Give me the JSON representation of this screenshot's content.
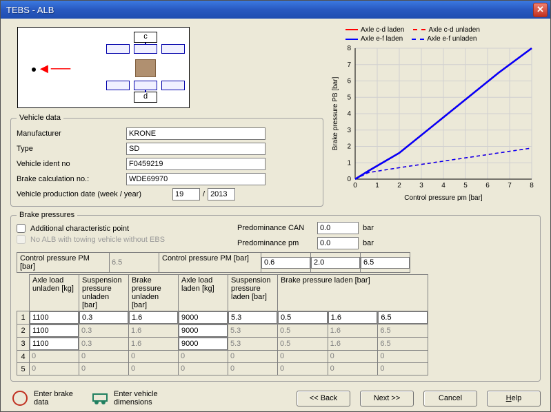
{
  "window": {
    "title": "TEBS - ALB"
  },
  "diagram": {
    "label_c": "c",
    "label_d": "d"
  },
  "vehicle_data": {
    "legend": "Vehicle data",
    "manufacturer_lbl": "Manufacturer",
    "manufacturer": "KRONE",
    "type_lbl": "Type",
    "type": "SD",
    "ident_lbl": "Vehicle ident no",
    "ident": "F0459219",
    "calc_lbl": "Brake calculation no.:",
    "calc": "WDE69970",
    "prod_date_lbl": "Vehicle production date (week / year)",
    "prod_week": "19",
    "prod_sep": "/",
    "prod_year": "2013"
  },
  "brake": {
    "legend": "Brake pressures",
    "addl_chk_lbl": "Additional characteristic point",
    "noalb_chk_lbl": "No ALB with towing vehicle without EBS",
    "pred_can_lbl": "Predominance CAN",
    "pred_can": "0.0",
    "pred_pm_lbl": "Predominance pm",
    "pred_pm": "0.0",
    "unit_bar": "bar",
    "cp_pm_lbl": "Control pressure PM [bar]",
    "cp_pm_left": "6.5",
    "cp_pm_r1": "0.6",
    "cp_pm_r2": "2.0",
    "cp_pm_r3": "6.5",
    "headers": {
      "c1": "Axle load unladen [kg]",
      "c2": "Suspension pressure unladen [bar]",
      "c3": "Brake pressure unladen [bar]",
      "c4": "Axle load laden [kg]",
      "c5": "Suspension pressure laden [bar]",
      "c6": "Brake pressure laden [bar]"
    },
    "rows": [
      {
        "n": "1",
        "c1": "1100",
        "c2": "0.3",
        "c3": "1.6",
        "c4": "9000",
        "c5": "5.3",
        "c6a": "0.5",
        "c6b": "1.6",
        "c6c": "6.5",
        "editable": true
      },
      {
        "n": "2",
        "c1": "1100",
        "c2": "0.3",
        "c3": "1.6",
        "c4": "9000",
        "c5": "5.3",
        "c6a": "0.5",
        "c6b": "1.6",
        "c6c": "6.5",
        "editable": false
      },
      {
        "n": "3",
        "c1": "1100",
        "c2": "0.3",
        "c3": "1.6",
        "c4": "9000",
        "c5": "5.3",
        "c6a": "0.5",
        "c6b": "1.6",
        "c6c": "6.5",
        "editable": false
      },
      {
        "n": "4",
        "c1": "0",
        "c2": "0",
        "c3": "0",
        "c4": "0",
        "c5": "0",
        "c6a": "0",
        "c6b": "0",
        "c6c": "0",
        "editable": false
      },
      {
        "n": "5",
        "c1": "0",
        "c2": "0",
        "c3": "0",
        "c4": "0",
        "c5": "0",
        "c6a": "0",
        "c6b": "0",
        "c6c": "0",
        "editable": false
      }
    ]
  },
  "buttons": {
    "enter_brake": "Enter brake data",
    "enter_veh": "Enter vehicle dimensions",
    "back": "<< Back",
    "next": "Next >>",
    "cancel": "Cancel",
    "help": "Help"
  },
  "chart_data": {
    "type": "line",
    "title": "",
    "xlabel": "Control pressure pm [bar]",
    "ylabel": "Brake pressure PB [bar]",
    "xlim": [
      0,
      8
    ],
    "ylim": [
      0,
      8
    ],
    "x": [
      0,
      0.6,
      2.0,
      6.5,
      8.0
    ],
    "series": [
      {
        "name": "Axle c-d laden",
        "color": "#ff0000",
        "dash": false,
        "values": [
          0,
          0.5,
          1.6,
          6.5,
          8.0
        ]
      },
      {
        "name": "Axle c-d unladen",
        "color": "#ff0000",
        "dash": true,
        "values": [
          0,
          0.4,
          0.7,
          1.6,
          1.9
        ]
      },
      {
        "name": "Axle e-f laden",
        "color": "#0000ff",
        "dash": false,
        "values": [
          0,
          0.5,
          1.6,
          6.5,
          8.0
        ]
      },
      {
        "name": "Axle e-f unladen",
        "color": "#0000ff",
        "dash": true,
        "values": [
          0,
          0.4,
          0.7,
          1.6,
          1.9
        ]
      }
    ]
  }
}
